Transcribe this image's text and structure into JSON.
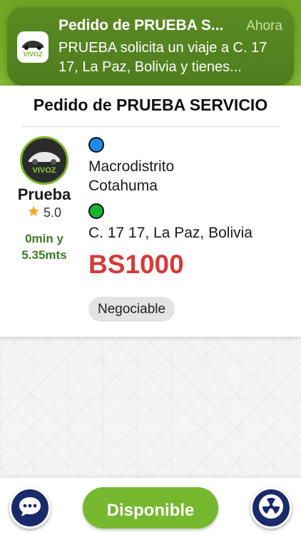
{
  "notification": {
    "title": "Pedido de PRUEBA S...",
    "time": "Ahora",
    "body": "PRUEBA solicita un viaje a C. 17 17, La Paz, Bolivia y tienes...",
    "app_logo_text": "VIVOZ",
    "icon": "app-logo-icon"
  },
  "order": {
    "title": "Pedido de PRUEBA SERVICIO",
    "driver": {
      "name": "Prueba",
      "rating": "5.0",
      "logo_text": "VIVOZ",
      "eta": "0min y 5.35mts"
    },
    "origin": "Macrodistrito Cotahuma",
    "destination": "C. 17 17, La Paz, Bolivia",
    "price": "BS1000",
    "badge": "Negociable"
  },
  "bottom_bar": {
    "available_label": "Disponible",
    "chat_icon": "chat-icon",
    "sos_icon": "radiation-icon"
  },
  "colors": {
    "brand_green": "#76b82e",
    "price_red": "#d63a3a",
    "navy": "#1b2a6b",
    "origin_blue": "#1f8be8",
    "destination_green": "#16b52e"
  }
}
